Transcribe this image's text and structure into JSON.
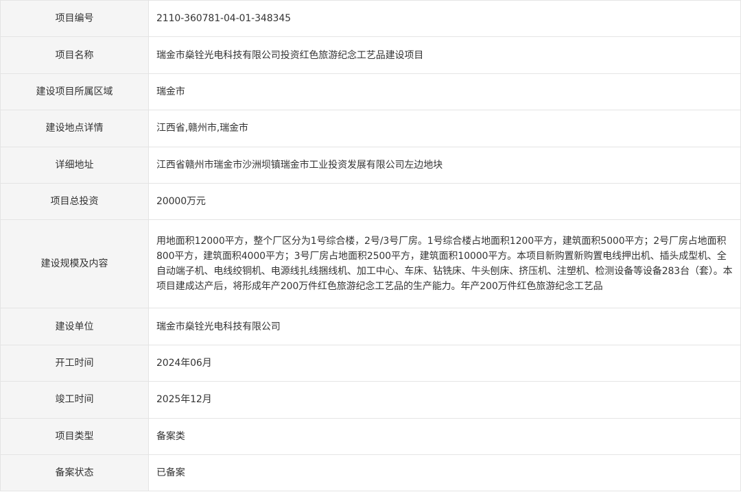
{
  "rows": [
    {
      "label": "项目编号",
      "value": "2110-360781-04-01-348345"
    },
    {
      "label": "项目名称",
      "value": "瑞金市燊铨光电科技有限公司投资红色旅游纪念工艺品建设项目"
    },
    {
      "label": "建设项目所属区域",
      "value": "瑞金市"
    },
    {
      "label": "建设地点详情",
      "value": "江西省,赣州市,瑞金市"
    },
    {
      "label": "详细地址",
      "value": "江西省赣州市瑞金市沙洲坝镇瑞金市工业投资发展有限公司左边地块"
    },
    {
      "label": "项目总投资",
      "value": "20000万元"
    },
    {
      "label": "建设规模及内容",
      "value": "用地面积12000平方，整个厂区分为1号综合楼，2号/3号厂房。1号综合楼占地面积1200平方，建筑面积5000平方；2号厂房占地面积800平方，建筑面积4000平方；3号厂房占地面积2500平方，建筑面积10000平方。本项目新购置新购置电线押出机、插头成型机、全自动端子机、电线绞铜机、电源线扎线捆线机、加工中心、车床、钻铣床、牛头刨床、挤压机、注塑机、检测设备等设备283台（套）。本项目建成达产后，将形成年产200万件红色旅游纪念工艺品的生产能力。年产200万件红色旅游纪念工艺品"
    },
    {
      "label": "建设单位",
      "value": "瑞金市燊铨光电科技有限公司"
    },
    {
      "label": "开工时间",
      "value": "2024年06月"
    },
    {
      "label": "竣工时间",
      "value": "2025年12月"
    },
    {
      "label": "项目类型",
      "value": "备案类"
    },
    {
      "label": "备案状态",
      "value": "已备案"
    }
  ]
}
